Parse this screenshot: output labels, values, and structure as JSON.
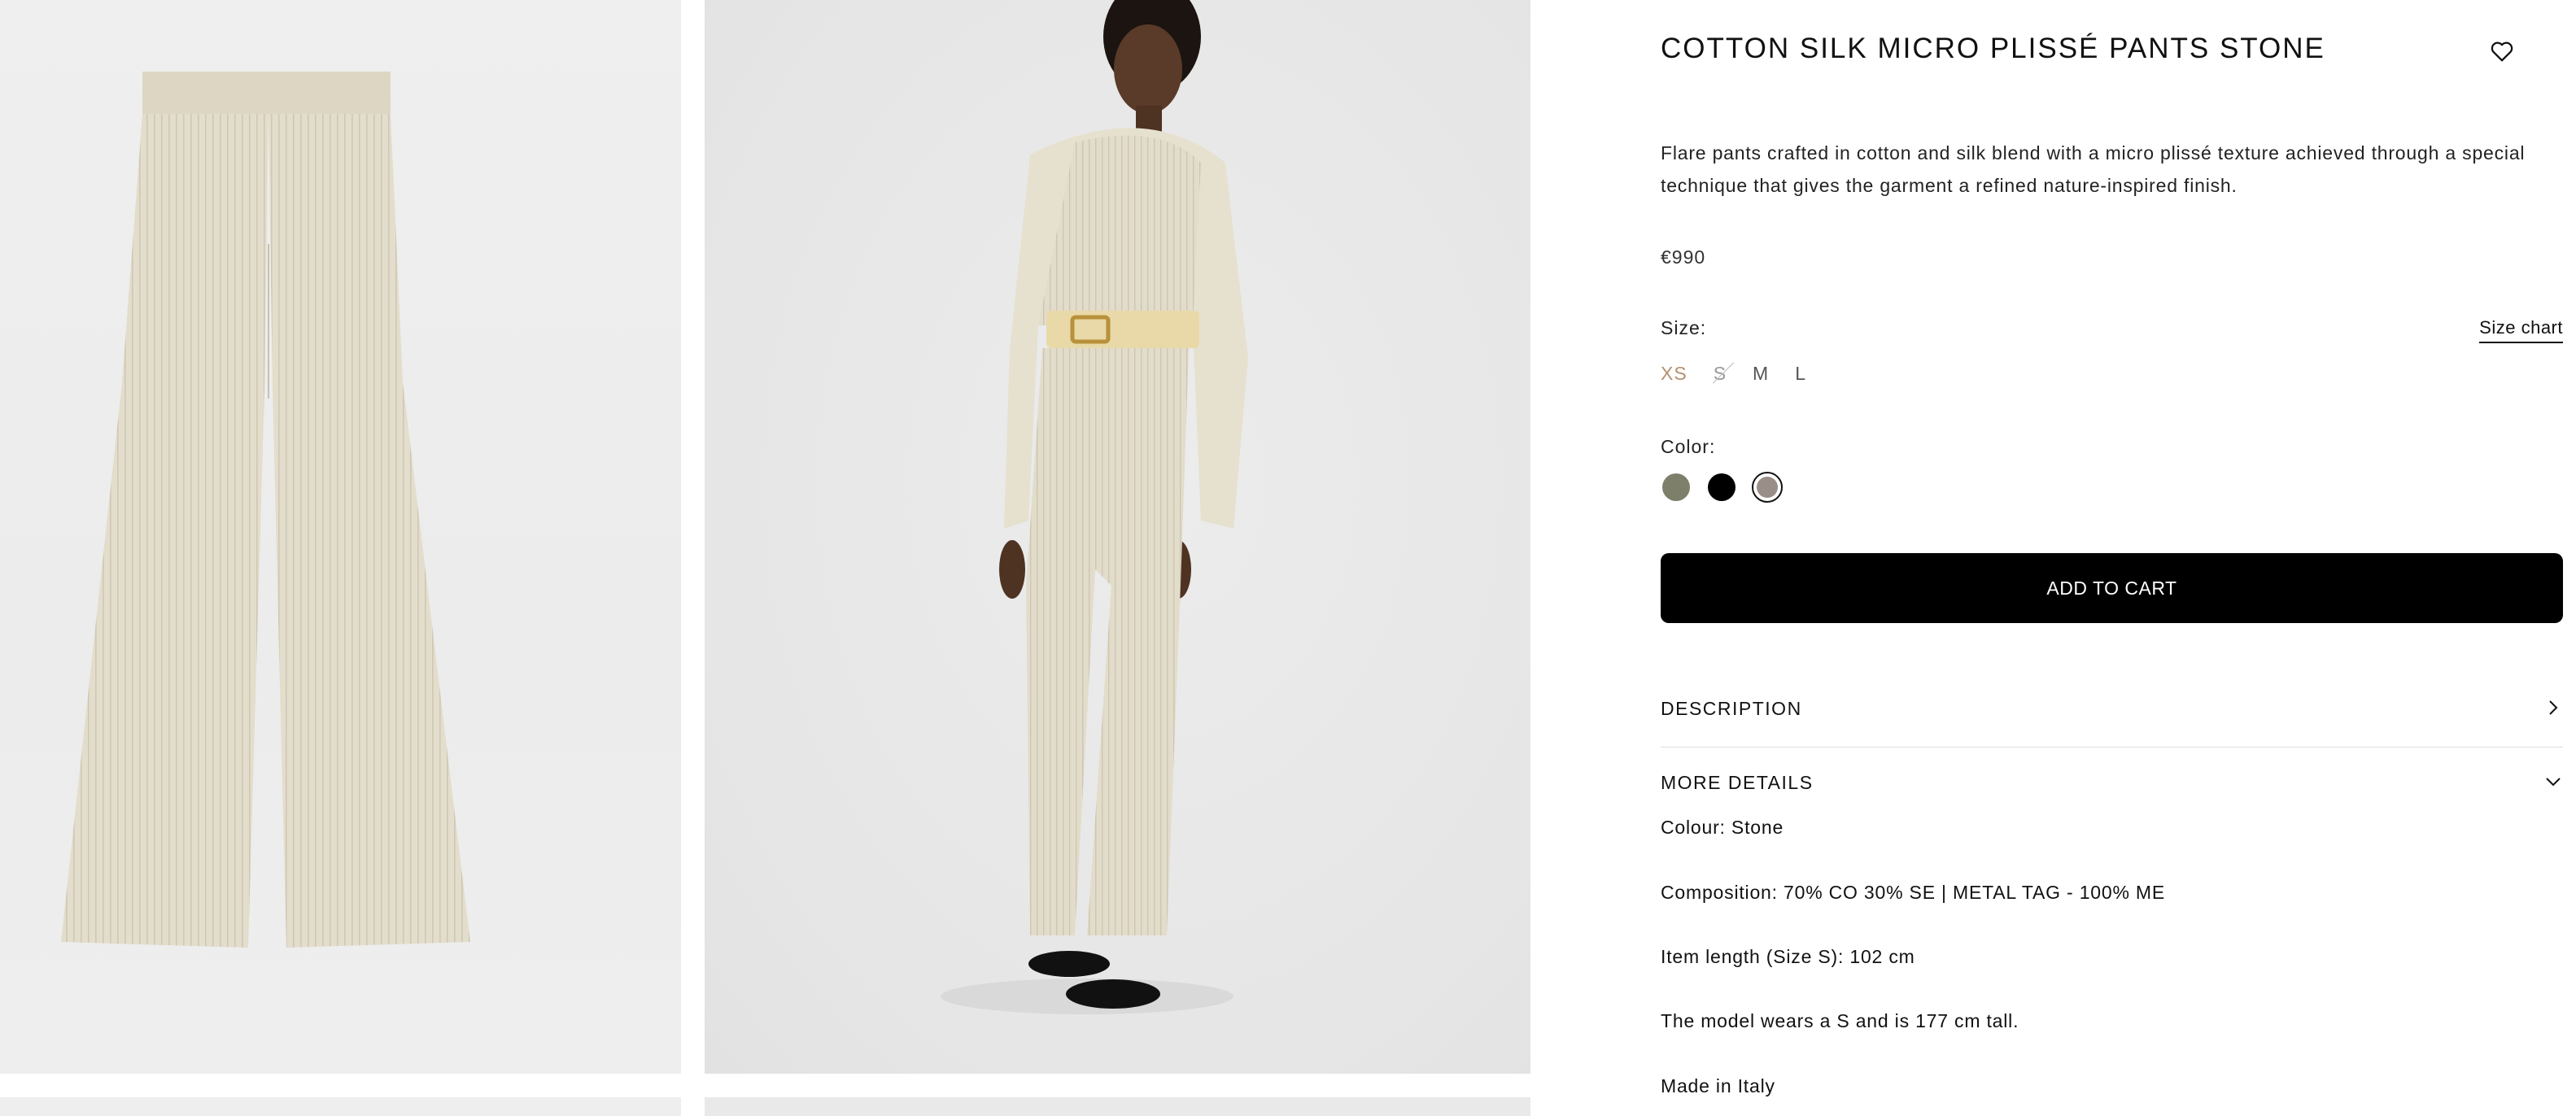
{
  "product": {
    "title": "COTTON SILK MICRO PLISSÉ PANTS STONE",
    "description": "Flare pants crafted in cotton and silk blend with a micro plissé texture achieved through a special technique that gives the garment a refined nature-inspired finish.",
    "price": "€990"
  },
  "icons": {
    "wishlist": "heart-icon",
    "description_toggle": "chevron-right-icon",
    "more_details_toggle": "chevron-down-icon"
  },
  "size": {
    "label": "Size:",
    "chart_link": "Size chart",
    "options": [
      {
        "label": "XS",
        "state": "selected"
      },
      {
        "label": "S",
        "state": "unavailable"
      },
      {
        "label": "M",
        "state": "available"
      },
      {
        "label": "L",
        "state": "available"
      }
    ]
  },
  "color": {
    "label": "Color:",
    "swatches": [
      {
        "name": "olive",
        "hex": "#7d7f6a",
        "selected": false
      },
      {
        "name": "black",
        "hex": "#000000",
        "selected": false
      },
      {
        "name": "stone",
        "hex": "#9a8e88",
        "selected": true
      }
    ]
  },
  "cart": {
    "button_label": "ADD TO CART"
  },
  "accordion": {
    "description_label": "DESCRIPTION",
    "more_details_label": "MORE DETAILS"
  },
  "more_details": {
    "colour": "Colour: Stone",
    "composition": "Composition: 70% CO 30% SE | METAL TAG - 100% ME",
    "item_length": "Item length (Size S): 102 cm",
    "model": "The model wears a S and is 177 cm tall.",
    "origin": "Made in Italy"
  },
  "colors": {
    "accent_selected_size": "#b49070",
    "cart_button": "#000000",
    "garment": "#e3ddcc"
  }
}
